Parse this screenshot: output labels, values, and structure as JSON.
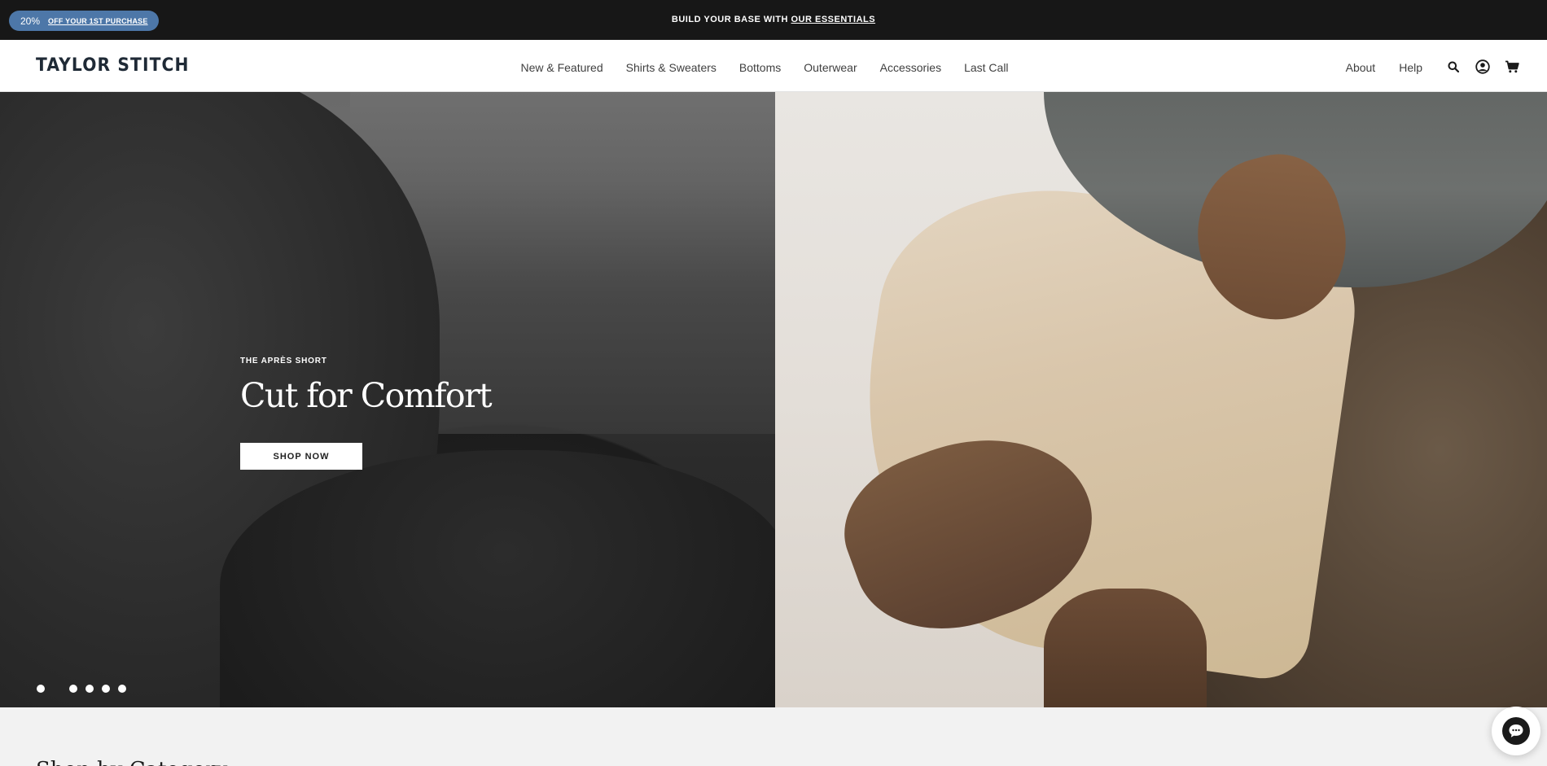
{
  "announcement": {
    "promo_percent": "20%",
    "promo_link": "OFF YOUR 1ST PURCHASE",
    "center_text": "BUILD YOUR BASE WITH ",
    "center_link": "OUR ESSENTIALS"
  },
  "header": {
    "logo": "TAYLOR STITCH",
    "nav": [
      "New & Featured",
      "Shirts & Sweaters",
      "Bottoms",
      "Outerwear",
      "Accessories",
      "Last Call"
    ],
    "utility": [
      "About",
      "Help"
    ],
    "icons": [
      "search-icon",
      "account-icon",
      "cart-icon"
    ]
  },
  "hero": {
    "eyebrow": "THE APRÈS SHORT",
    "headline": "Cut for Comfort",
    "cta": "SHOP NOW",
    "slide_count": 6,
    "active_slide": 2
  },
  "section": {
    "title": "Shop by Category"
  },
  "colors": {
    "announce_bg": "#171717",
    "promo_bg": "#4d77a8",
    "logo": "#1f2a36"
  }
}
